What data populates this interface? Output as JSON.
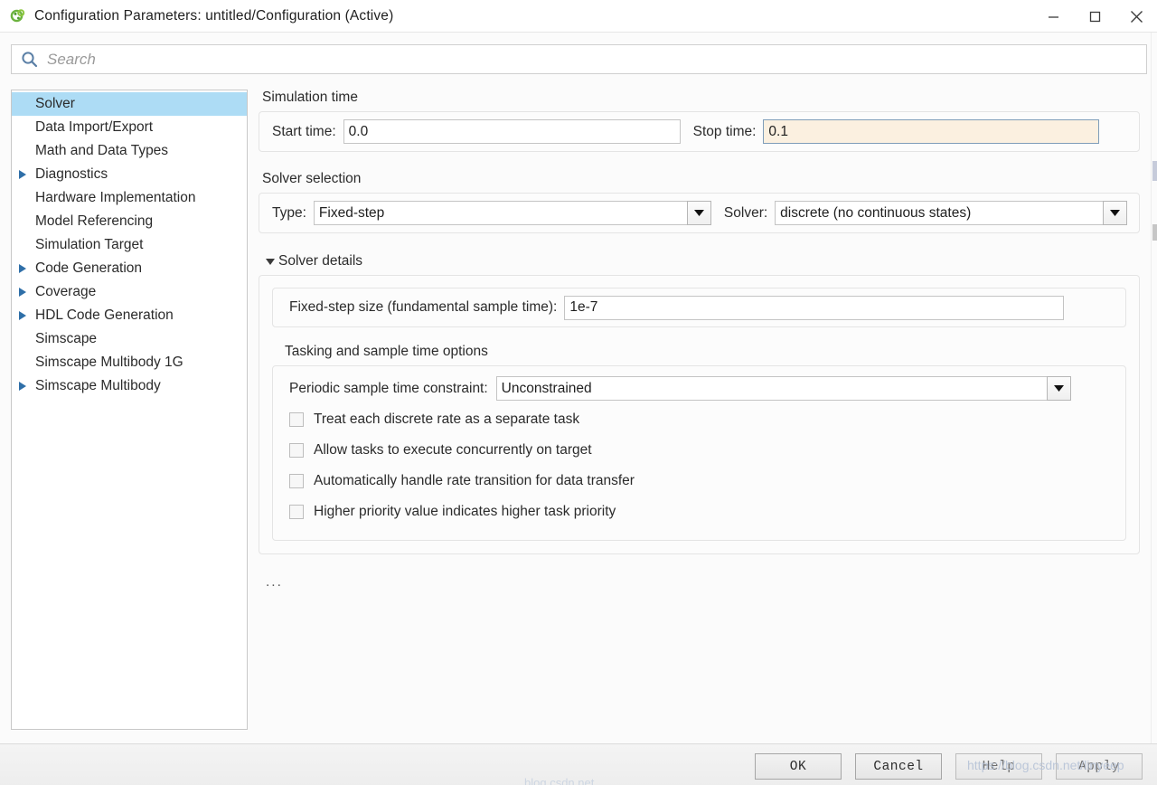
{
  "window": {
    "title": "Configuration Parameters: untitled/Configuration (Active)",
    "icon": "simulink-icon",
    "minimize_label": "–",
    "maximize_label": "□",
    "close_label": "✕"
  },
  "search": {
    "placeholder": "Search",
    "value": "",
    "icon": "search-icon"
  },
  "sidebar": {
    "items": [
      {
        "label": "Solver",
        "expandable": false,
        "selected": true
      },
      {
        "label": "Data Import/Export",
        "expandable": false,
        "selected": false
      },
      {
        "label": "Math and Data Types",
        "expandable": false,
        "selected": false
      },
      {
        "label": "Diagnostics",
        "expandable": true,
        "selected": false
      },
      {
        "label": "Hardware Implementation",
        "expandable": false,
        "selected": false
      },
      {
        "label": "Model Referencing",
        "expandable": false,
        "selected": false
      },
      {
        "label": "Simulation Target",
        "expandable": false,
        "selected": false
      },
      {
        "label": "Code Generation",
        "expandable": true,
        "selected": false
      },
      {
        "label": "Coverage",
        "expandable": true,
        "selected": false
      },
      {
        "label": "HDL Code Generation",
        "expandable": true,
        "selected": false
      },
      {
        "label": "Simscape",
        "expandable": false,
        "selected": false
      },
      {
        "label": "Simscape Multibody 1G",
        "expandable": false,
        "selected": false
      },
      {
        "label": "Simscape Multibody",
        "expandable": true,
        "selected": false
      }
    ]
  },
  "main": {
    "simulation_time": {
      "group_title": "Simulation time",
      "start_time_label": "Start time:",
      "start_time_value": "0.0",
      "stop_time_label": "Stop time:",
      "stop_time_value": "0.1",
      "stop_time_modified": true
    },
    "solver_selection": {
      "group_title": "Solver selection",
      "type_label": "Type:",
      "type_value": "Fixed-step",
      "solver_label": "Solver:",
      "solver_value": "discrete (no continuous states)"
    },
    "solver_details": {
      "disclosure_label": "Solver details",
      "expanded": true,
      "fixed_step_label": "Fixed-step size (fundamental sample time):",
      "fixed_step_value": "1e-7",
      "tasking_title": "Tasking and sample time options",
      "periodic_label": "Periodic sample time constraint:",
      "periodic_value": "Unconstrained",
      "checkboxes": [
        {
          "label": "Treat each discrete rate as a separate task",
          "checked": false
        },
        {
          "label": "Allow tasks to execute concurrently on target",
          "checked": false
        },
        {
          "label": "Automatically handle rate transition for data transfer",
          "checked": false
        },
        {
          "label": "Higher priority value indicates higher task priority",
          "checked": false
        }
      ]
    },
    "overflow_indicator": "..."
  },
  "footer": {
    "buttons": [
      {
        "label": "OK",
        "dim": false
      },
      {
        "label": "Cancel",
        "dim": false
      },
      {
        "label": "Help",
        "dim": true
      },
      {
        "label": "Apply",
        "dim": true
      }
    ]
  },
  "overlay": {
    "watermark": "https://blog.csdn.net/linyeep",
    "watermark2": "blog.csdn.net"
  },
  "colors": {
    "selection": "#addcf5",
    "modified_field": "#fbf0e0",
    "focus_border": "#7f9db9",
    "icon_green": "#6cb33f"
  }
}
